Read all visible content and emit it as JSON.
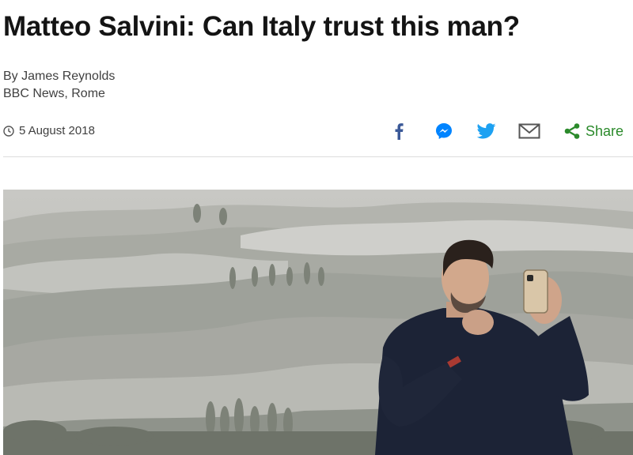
{
  "article": {
    "headline": "Matteo Salvini: Can Italy trust this man?",
    "author": "By James Reynolds",
    "outlet": "BBC News, Rome",
    "date": "5 August 2018"
  },
  "share": {
    "label": "Share",
    "icons": [
      "facebook-icon",
      "messenger-icon",
      "twitter-icon",
      "email-icon",
      "share-icon"
    ]
  },
  "colors": {
    "headline": "#141414",
    "share_green": "#2b8a2b",
    "facebook": "#3b5998",
    "messenger": "#0084ff",
    "twitter": "#1da1f2",
    "email": "#555555",
    "sky": "#c9c9c5",
    "suit": "#1c2336"
  },
  "photo": {
    "subject": "Man in a dark shirt taking a selfie with a phone in front of a hazy rolling hillside landscape with cypress trees"
  }
}
